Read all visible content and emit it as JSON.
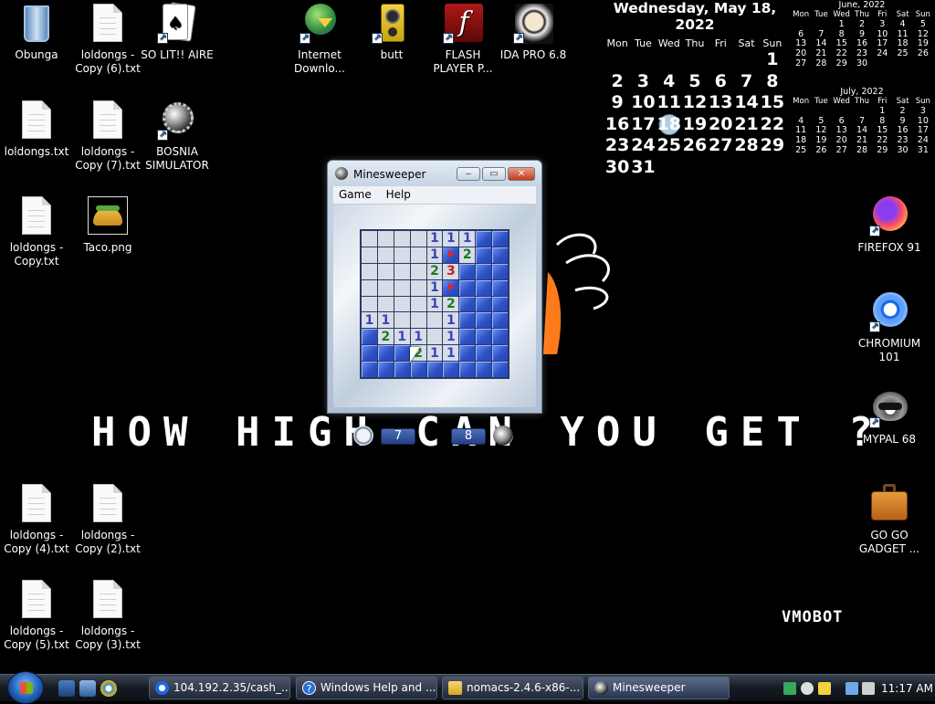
{
  "desktop_icons": [
    {
      "id": "obunga",
      "label": "Obunga",
      "kind": "recycle-bin"
    },
    {
      "id": "loldongs-copy-6",
      "label": "loldongs - Copy (6).txt",
      "kind": "text-file"
    },
    {
      "id": "so-lit-aire",
      "label": "SO LIT!! AIRE",
      "kind": "cards"
    },
    {
      "id": "internet-download",
      "label": "Internet Downlo...",
      "kind": "download"
    },
    {
      "id": "butt",
      "label": "butt",
      "kind": "speaker"
    },
    {
      "id": "flash-player",
      "label": "FLASH PLAYER P...",
      "kind": "flash"
    },
    {
      "id": "ida-pro",
      "label": "IDA PRO 6.8",
      "kind": "portrait"
    },
    {
      "id": "loldongs",
      "label": "loldongs.txt",
      "kind": "text-file"
    },
    {
      "id": "loldongs-copy-7",
      "label": "loldongs - Copy (7).txt",
      "kind": "text-file"
    },
    {
      "id": "bosnia-simulator",
      "label": "BOSNIA SIMULATOR",
      "kind": "mine"
    },
    {
      "id": "loldongs-copy",
      "label": "loldongs - Copy.txt",
      "kind": "text-file"
    },
    {
      "id": "taco",
      "label": "Taco.png",
      "kind": "image"
    },
    {
      "id": "firefox",
      "label": "FIREFOX 91",
      "kind": "firefox"
    },
    {
      "id": "chromium",
      "label": "CHROMIUM 101",
      "kind": "chromium"
    },
    {
      "id": "mypal",
      "label": "MYPAL 68",
      "kind": "raccoon"
    },
    {
      "id": "go-go-gadget",
      "label": "GO GO GADGET ...",
      "kind": "briefcase"
    },
    {
      "id": "loldongs-copy-4",
      "label": "loldongs - Copy (4).txt",
      "kind": "text-file"
    },
    {
      "id": "loldongs-copy-2",
      "label": "loldongs - Copy (2).txt",
      "kind": "text-file"
    },
    {
      "id": "loldongs-copy-5",
      "label": "loldongs - Copy (5).txt",
      "kind": "text-file"
    },
    {
      "id": "loldongs-copy-3",
      "label": "loldongs - Copy (3).txt",
      "kind": "text-file"
    }
  ],
  "calendar": {
    "header": "Wednesday, May 18, 2022",
    "dow": [
      "Mon",
      "Tue",
      "Wed",
      "Thu",
      "Fri",
      "Sat",
      "Sun"
    ],
    "days": [
      "",
      "",
      "",
      "",
      "",
      "",
      "1",
      "2",
      "3",
      "4",
      "5",
      "6",
      "7",
      "8",
      "9",
      "10",
      "11",
      "12",
      "13",
      "14",
      "15",
      "16",
      "17",
      "18",
      "19",
      "20",
      "21",
      "22",
      "23",
      "24",
      "25",
      "26",
      "27",
      "28",
      "29",
      "30",
      "31"
    ],
    "today": "18",
    "june": {
      "header": "June, 2022",
      "days": [
        "",
        "",
        "1",
        "2",
        "3",
        "4",
        "5",
        "6",
        "7",
        "8",
        "9",
        "10",
        "11",
        "12",
        "13",
        "14",
        "15",
        "16",
        "17",
        "18",
        "19",
        "20",
        "21",
        "22",
        "23",
        "24",
        "25",
        "26",
        "27",
        "28",
        "29",
        "30"
      ]
    },
    "july": {
      "header": "July, 2022",
      "days": [
        "",
        "",
        "",
        "",
        "1",
        "2",
        "3",
        "4",
        "5",
        "6",
        "7",
        "8",
        "9",
        "10",
        "11",
        "12",
        "13",
        "14",
        "15",
        "16",
        "17",
        "18",
        "19",
        "20",
        "21",
        "22",
        "23",
        "24",
        "25",
        "26",
        "27",
        "28",
        "29",
        "30",
        "31"
      ]
    }
  },
  "wallpaper": {
    "text": "HOW HIGH CAN YOU GET ?",
    "watermark": "VMOBOT"
  },
  "minesweeper": {
    "title": "Minesweeper",
    "menu": [
      "Game",
      "Help"
    ],
    "time": "7",
    "mines": "8",
    "board": [
      [
        "o",
        "o",
        "o",
        "o",
        "1",
        "1",
        "1",
        "u",
        "u"
      ],
      [
        "o",
        "o",
        "o",
        "o",
        "1",
        "f",
        "2",
        "u",
        "u"
      ],
      [
        "o",
        "o",
        "o",
        "o",
        "2",
        "3",
        "u",
        "u",
        "u"
      ],
      [
        "o",
        "o",
        "o",
        "o",
        "1",
        "f",
        "u",
        "u",
        "u"
      ],
      [
        "o",
        "o",
        "o",
        "o",
        "1",
        "2",
        "u",
        "u",
        "u"
      ],
      [
        "1",
        "1",
        "o",
        "o",
        "o",
        "1",
        "u",
        "u",
        "u"
      ],
      [
        "u",
        "2",
        "1",
        "1",
        "o",
        "1",
        "u",
        "u",
        "u"
      ],
      [
        "u",
        "u",
        "u",
        "2",
        "1",
        "1",
        "u",
        "u",
        "u"
      ],
      [
        "u",
        "u",
        "u",
        "u",
        "u",
        "u",
        "u",
        "u",
        "u"
      ]
    ]
  },
  "taskbar": {
    "buttons": [
      {
        "label": "104.192.2.35/cash_...",
        "icon": "chromium-icon"
      },
      {
        "label": "Windows Help and ...",
        "icon": "help-icon"
      },
      {
        "label": "nomacs-2.4.6-x86-...",
        "icon": "folder-icon"
      },
      {
        "label": "Minesweeper",
        "icon": "mine-icon"
      }
    ],
    "clock": "11:17 AM"
  }
}
